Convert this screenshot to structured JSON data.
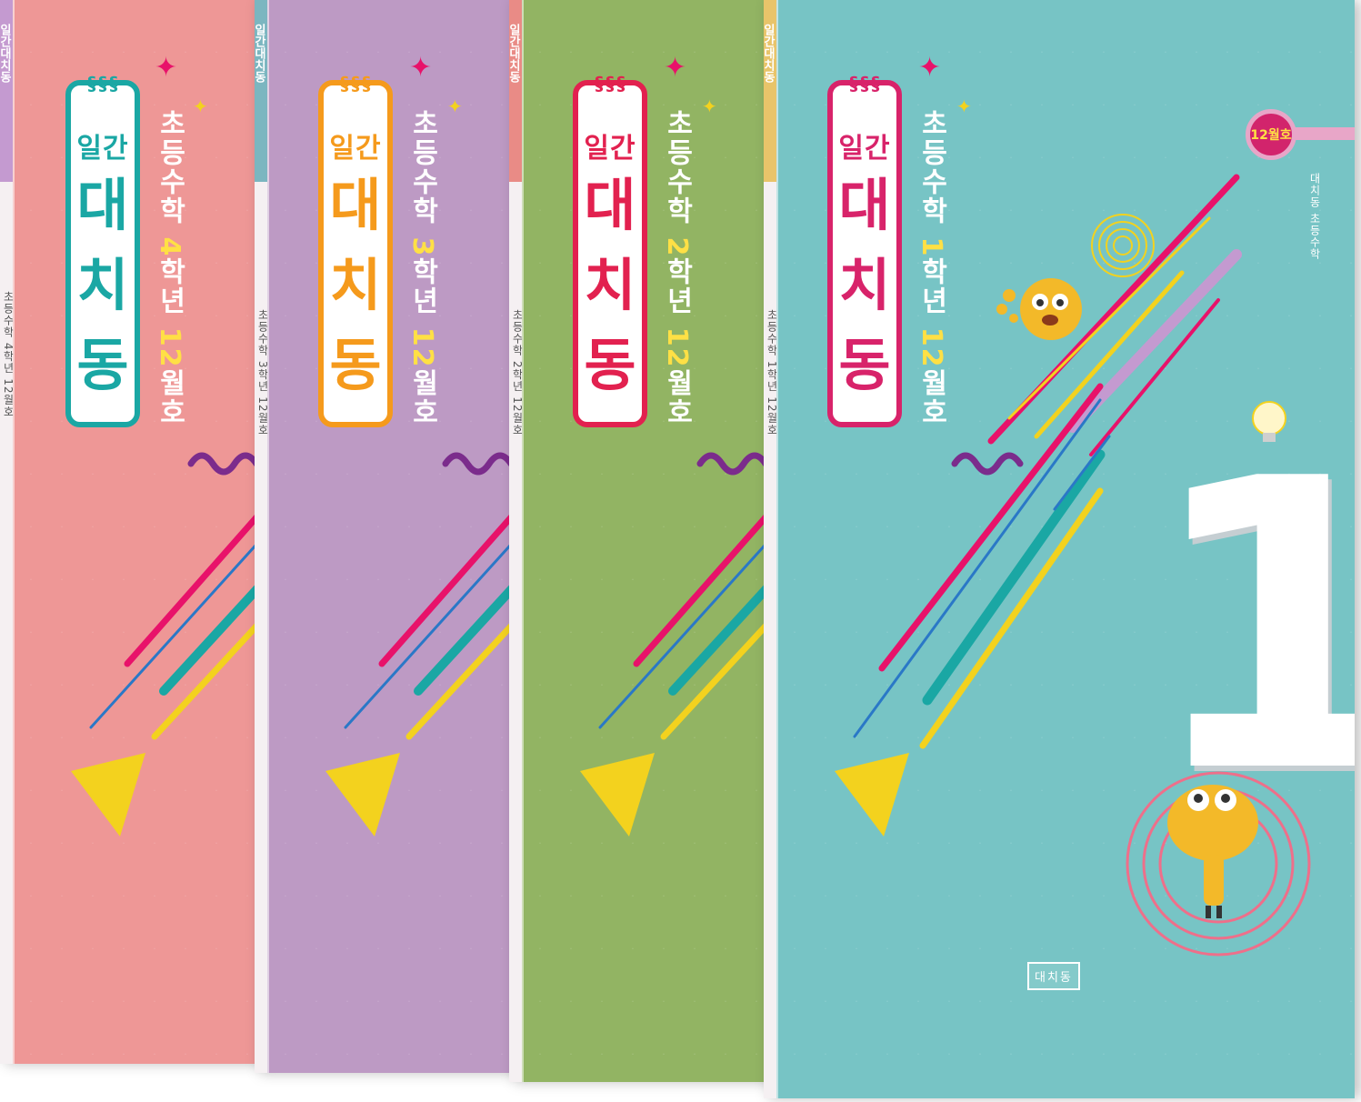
{
  "series": {
    "title_small": "일간",
    "title_chars": [
      "대",
      "치",
      "동"
    ],
    "subject": "초등수학",
    "grade_suffix": "학년",
    "issue": "12",
    "issue_suffix": "월호"
  },
  "books": [
    {
      "grade": "4",
      "spine_text": "초등수학 4학년 12월호",
      "spine_label": "일간대치동",
      "bg": "#ee9796",
      "accent": "#1aa7a4"
    },
    {
      "grade": "3",
      "spine_text": "초등수학 3학년 12월호",
      "spine_label": "일간대치동",
      "bg": "#bd9ac4",
      "accent": "#f59a1c"
    },
    {
      "grade": "2",
      "spine_text": "초등수학 2학년 12월호",
      "spine_label": "일간대치동",
      "bg": "#92b463",
      "accent": "#e2214f"
    },
    {
      "grade": "1",
      "spine_text": "초등수학 1학년 12월호",
      "spine_label": "일간대치동",
      "bg": "#77c4c5",
      "accent": "#d8236a"
    }
  ],
  "front": {
    "badge": "12월호",
    "publisher_vertical": "대치동 초등수학",
    "big_numeral": "1",
    "logo": "대치동"
  },
  "colors": {
    "pink": "#e8126a",
    "yellow": "#f3d21e",
    "teal": "#1aa7a4",
    "purple": "#7b2c8c",
    "blue": "#2a78c7"
  }
}
